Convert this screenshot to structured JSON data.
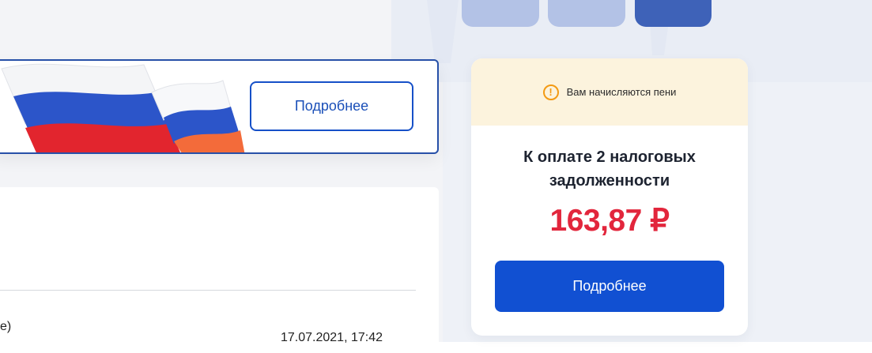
{
  "banner": {
    "more_label": "Подробнее"
  },
  "list": {
    "row_fragment_text": "е)",
    "row_date": "17.07.2021, 17:42"
  },
  "tax_card": {
    "warning_text": "Вам начисляются пени",
    "title": "К оплате 2 налоговых задолженности",
    "amount": "163,87 ₽",
    "button_label": "Подробнее"
  },
  "colors": {
    "accent": "#1150d2",
    "amount_red": "#e2263c",
    "warning_bg": "#fcf3dd",
    "warning_icon": "#f39a13",
    "banner_border": "#2750a8"
  },
  "icons": {
    "warning": "exclamation-circle-icon",
    "flag": "russian-flag-illustration"
  }
}
